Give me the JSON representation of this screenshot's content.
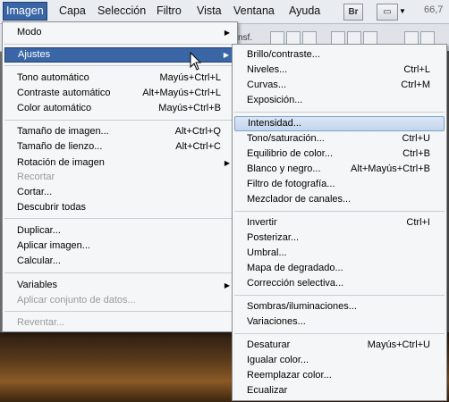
{
  "menubar": {
    "items": [
      "Imagen",
      "Capa",
      "Selección",
      "Filtro",
      "Vista",
      "Ventana",
      "Ayuda"
    ],
    "bridge_label": "Br",
    "zoom": "66,7"
  },
  "optbar": {
    "fragment": "nsf."
  },
  "imagen_menu": {
    "modo": "Modo",
    "ajustes": "Ajustes",
    "tono_auto": "Tono automático",
    "tono_auto_sc": "Mayús+Ctrl+L",
    "contraste_auto": "Contraste automático",
    "contraste_auto_sc": "Alt+Mayús+Ctrl+L",
    "color_auto": "Color automático",
    "color_auto_sc": "Mayús+Ctrl+B",
    "tam_imagen": "Tamaño de imagen...",
    "tam_imagen_sc": "Alt+Ctrl+Q",
    "tam_lienzo": "Tamaño de lienzo...",
    "tam_lienzo_sc": "Alt+Ctrl+C",
    "rotacion": "Rotación de imagen",
    "recortar": "Recortar",
    "cortar": "Cortar...",
    "descubrir": "Descubrir todas",
    "duplicar": "Duplicar...",
    "aplicar_imagen": "Aplicar imagen...",
    "calcular": "Calcular...",
    "variables": "Variables",
    "aplicar_conjunto": "Aplicar conjunto de datos...",
    "reventar": "Reventar..."
  },
  "ajustes_menu": {
    "brillo": "Brillo/contraste...",
    "niveles": "Niveles...",
    "niveles_sc": "Ctrl+L",
    "curvas": "Curvas...",
    "curvas_sc": "Ctrl+M",
    "exposicion": "Exposición...",
    "intensidad": "Intensidad...",
    "tono_sat": "Tono/saturación...",
    "tono_sat_sc": "Ctrl+U",
    "equilibrio": "Equilibrio de color...",
    "equilibrio_sc": "Ctrl+B",
    "blanco_negro": "Blanco y negro...",
    "blanco_negro_sc": "Alt+Mayús+Ctrl+B",
    "filtro_foto": "Filtro de fotografía...",
    "mezclador": "Mezclador de canales...",
    "invertir": "Invertir",
    "invertir_sc": "Ctrl+I",
    "posterizar": "Posterizar...",
    "umbral": "Umbral...",
    "mapa_degradado": "Mapa de degradado...",
    "correccion": "Corrección selectiva...",
    "sombras": "Sombras/iluminaciones...",
    "variaciones": "Variaciones...",
    "desaturar": "Desaturar",
    "desaturar_sc": "Mayús+Ctrl+U",
    "igualar": "Igualar color...",
    "reemplazar": "Reemplazar color...",
    "ecualizar": "Ecualizar"
  },
  "colors": {
    "menu_highlight": "#3a66a6",
    "hover_highlight": "#c2d5ee"
  }
}
